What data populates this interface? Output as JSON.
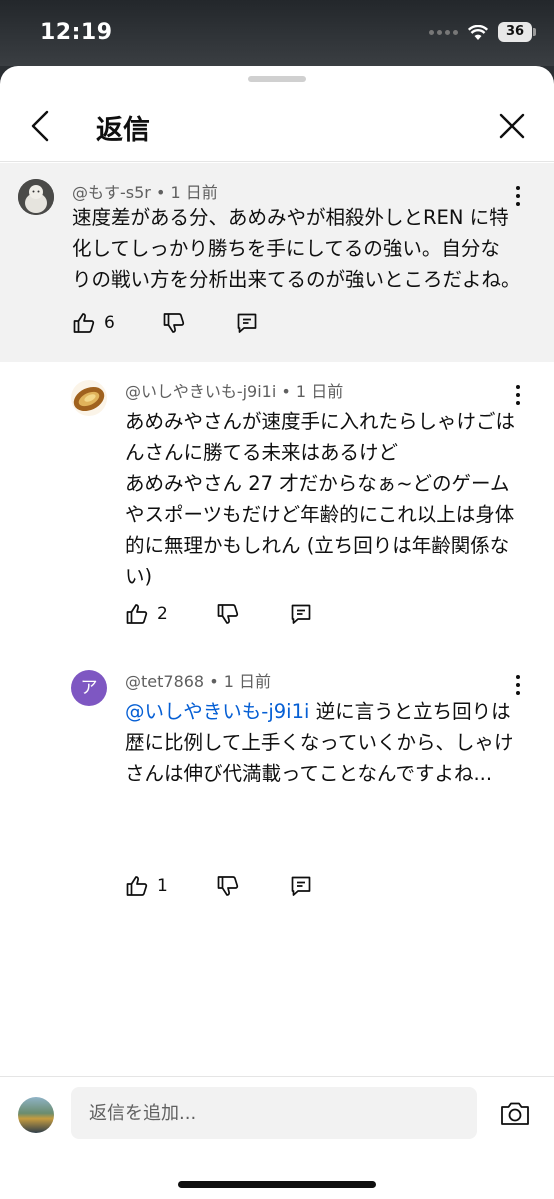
{
  "status": {
    "time": "12:19",
    "battery": "36"
  },
  "header": {
    "title": "返信"
  },
  "comments": [
    {
      "author": "@もす-s5r",
      "age": "1 日前",
      "lines": [
        "速度差がある分、あめみやが相殺外しとREN に特",
        "化してしっかり勝ちを手にしてるの強い。自分な",
        "りの戦い方を分析出来てるのが強いところだよね。"
      ],
      "likes": "6"
    },
    {
      "author": "@いしやきいも-j9i1i",
      "age": "1 日前",
      "lines": [
        "あめみやさんが速度手に入れたらしゃけごは",
        "んさんに勝てる未来はあるけど",
        "あめみやさん 27 才だからなぁ~どのゲーム",
        "やスポーツもだけど年齢的にこれ以上は身体",
        "的に無理かもしれん (立ち回りは年齢関係な",
        "い)"
      ],
      "likes": "2"
    },
    {
      "author": "@tet7868",
      "age": "1 日前",
      "avatar_letter": "ア",
      "avatar_color": "#7e57c2",
      "mention": "@いしやきいも-j9i1i",
      "line1_rest": " 逆に言うと立ち回りは",
      "lines": [
        "歴に比例して上手くなっていくから、しゃけ",
        "さんは伸び代満載ってことなんですよね..."
      ],
      "likes": "1"
    }
  ],
  "reply": {
    "placeholder": "返信を追加..."
  },
  "separator": " • "
}
